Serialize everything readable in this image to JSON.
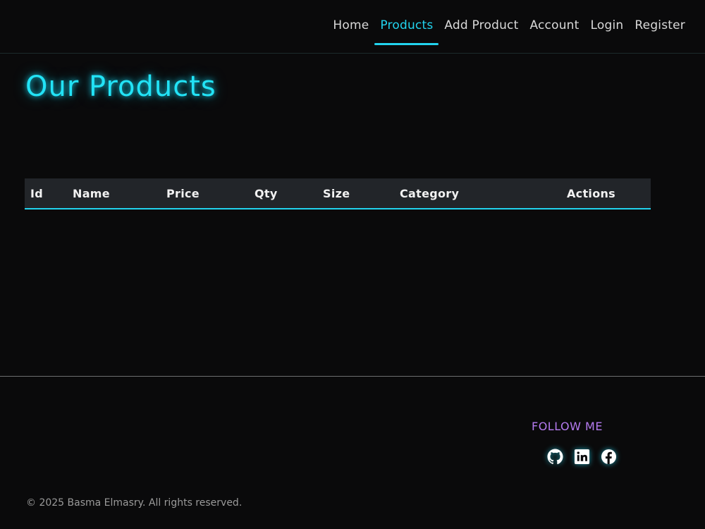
{
  "nav": {
    "items": [
      {
        "label": "Home",
        "active": false
      },
      {
        "label": "Products",
        "active": true
      },
      {
        "label": "Add Product",
        "active": false
      },
      {
        "label": "Account",
        "active": false
      },
      {
        "label": "Login",
        "active": false
      },
      {
        "label": "Register",
        "active": false
      }
    ]
  },
  "main": {
    "title": "Our Products",
    "table": {
      "columns": [
        "Id",
        "Name",
        "Price",
        "Qty",
        "Size",
        "Category",
        "Actions"
      ],
      "rows": []
    }
  },
  "footer": {
    "follow_title": "FOLLOW ME",
    "social": [
      {
        "icon": "github-icon"
      },
      {
        "icon": "linkedin-icon"
      },
      {
        "icon": "facebook-icon"
      }
    ],
    "copyright": "© 2025 Basma Elmasry. All rights reserved."
  },
  "colors": {
    "accent": "#22d3ee",
    "follow": "#b57bf0",
    "background": "#0a0a0b"
  }
}
